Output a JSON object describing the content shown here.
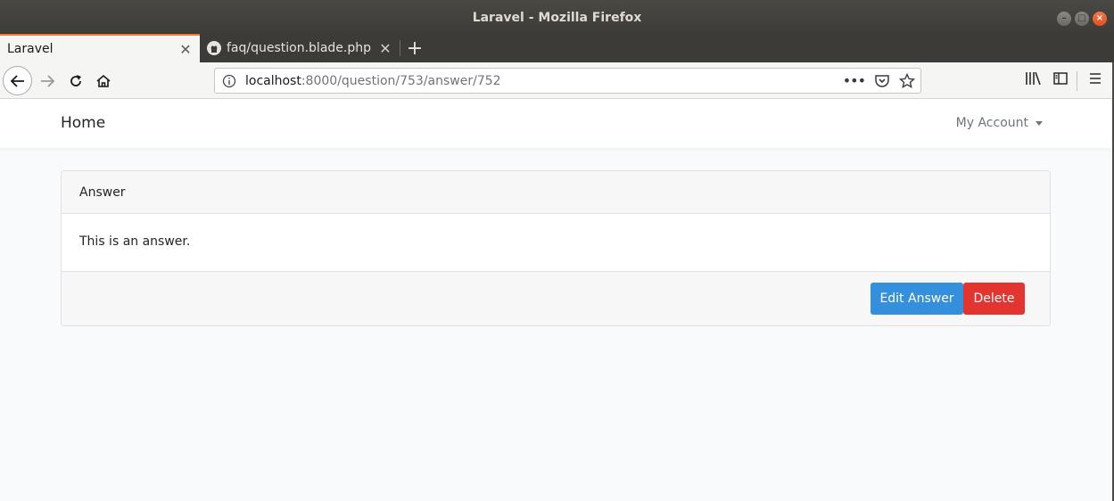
{
  "window": {
    "title": "Laravel - Mozilla Firefox"
  },
  "tabs": [
    {
      "label": "Laravel",
      "active": true
    },
    {
      "label": "faq/question.blade.php",
      "active": false
    }
  ],
  "urlbar": {
    "host": "localhost",
    "path": ":8000/question/753/answer/752"
  },
  "site": {
    "brand": "Home",
    "account_menu": "My Account"
  },
  "card": {
    "header": "Answer",
    "body": "This is an answer.",
    "edit_button": "Edit Answer",
    "delete_button": "Delete"
  },
  "colors": {
    "primary": "#3490dc",
    "danger": "#e3342f",
    "tab_accent": "#ee7a37"
  },
  "icons": [
    "back-icon",
    "forward-icon",
    "reload-icon",
    "home-icon",
    "info-icon",
    "more-icon",
    "pocket-icon",
    "bookmark-star-icon",
    "library-icon",
    "sidebar-icon",
    "menu-icon",
    "github-icon"
  ]
}
